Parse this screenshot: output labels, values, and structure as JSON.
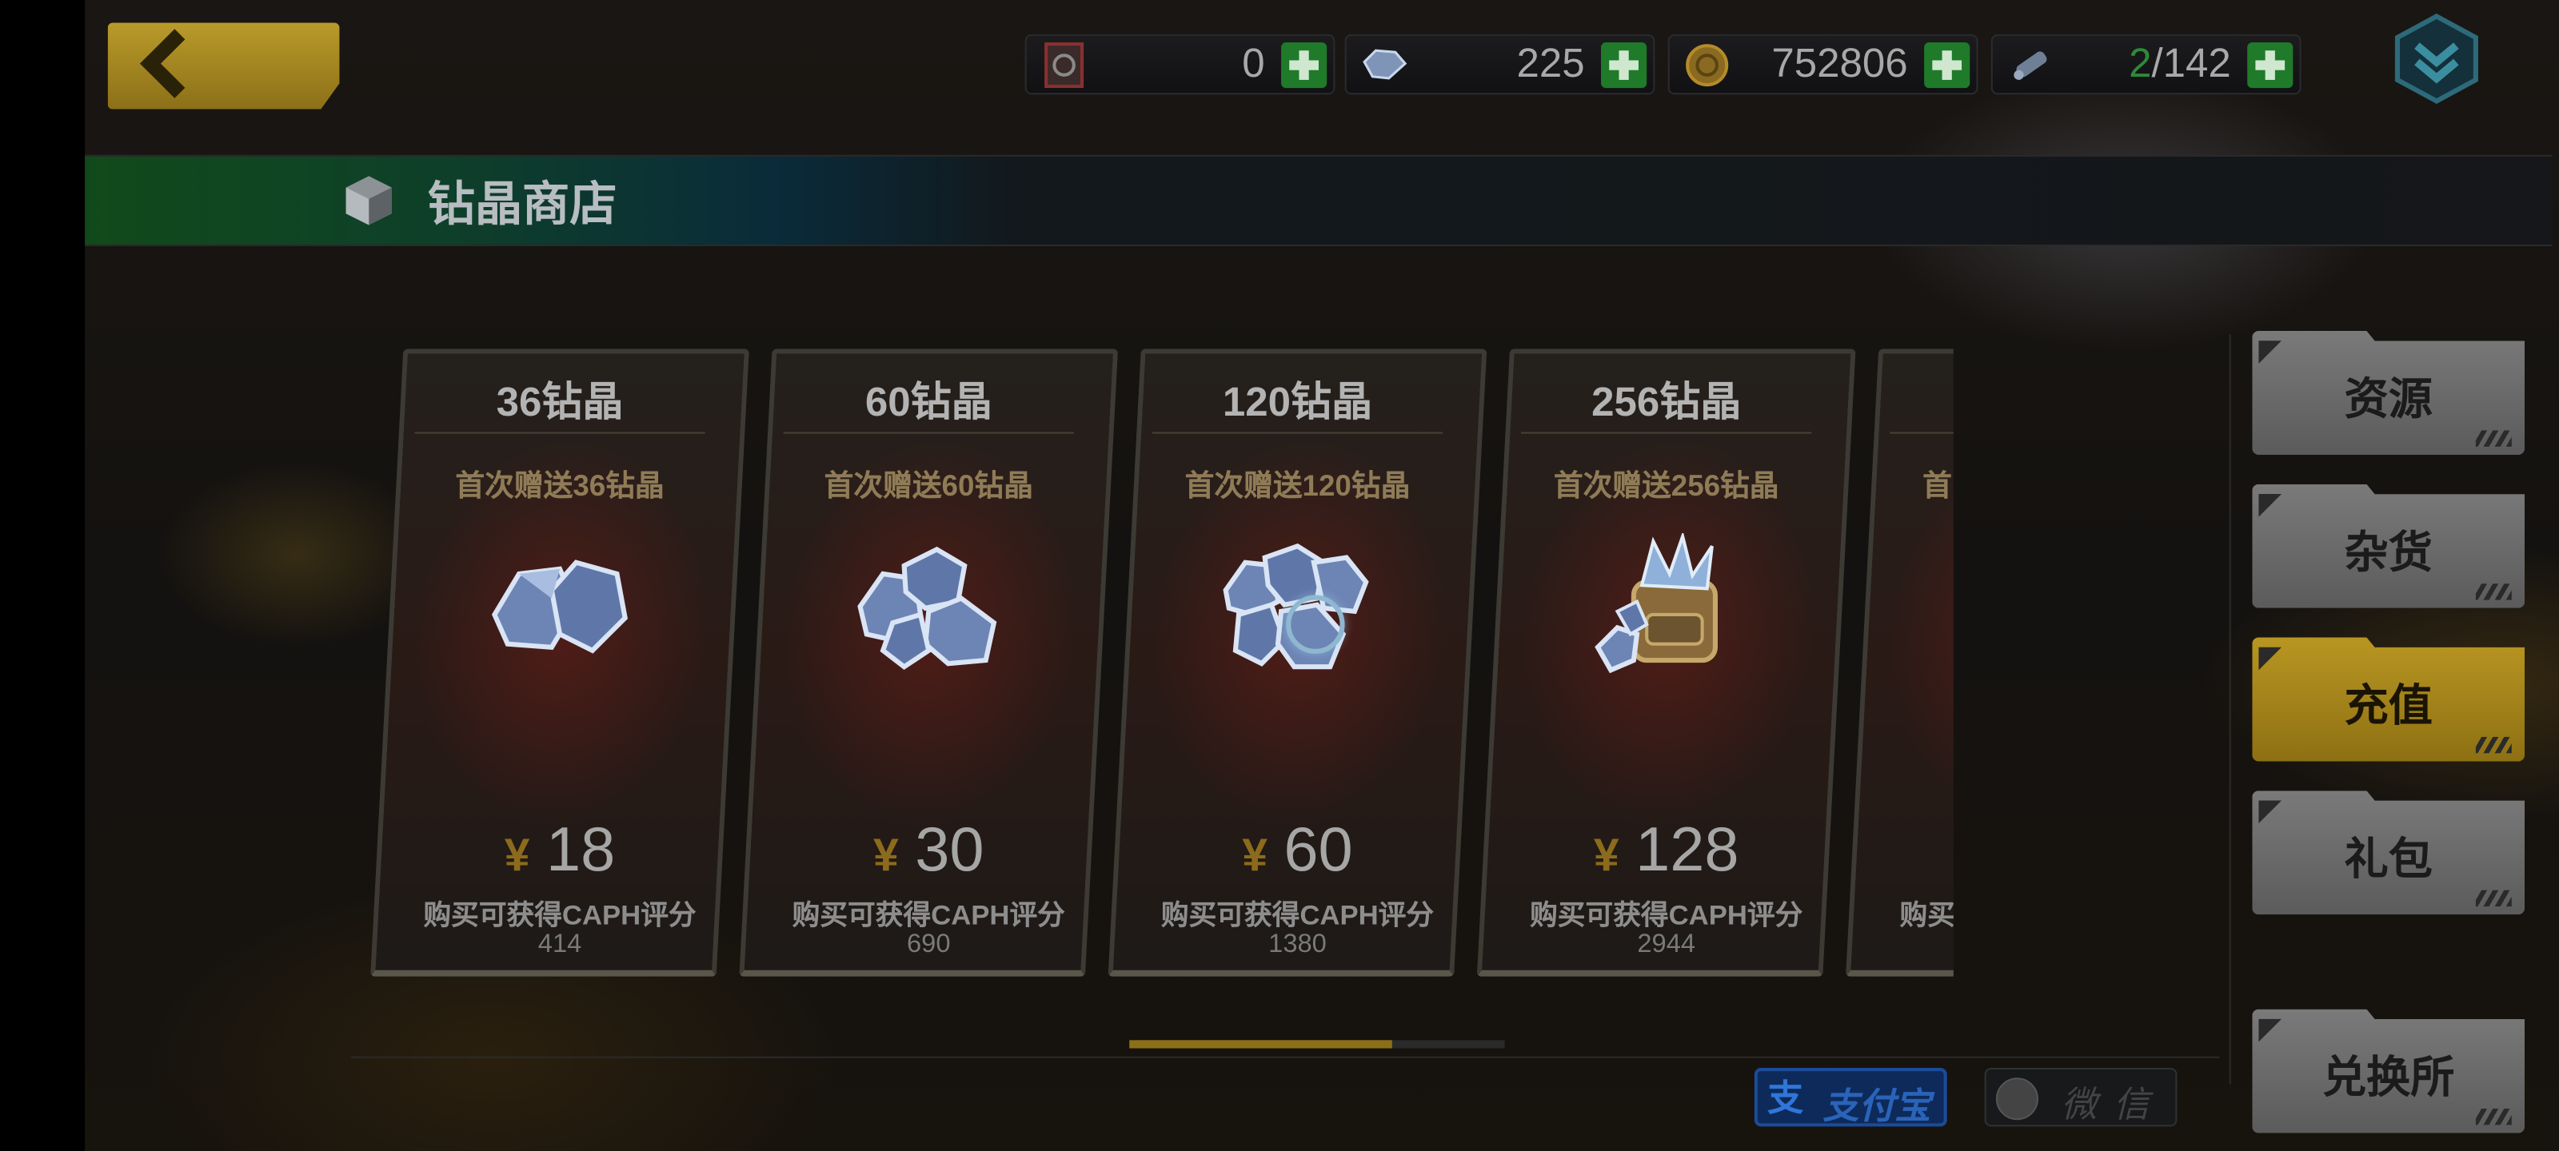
{
  "topbar": {
    "back_label": "",
    "resources": [
      {
        "name": "badge",
        "value": "0"
      },
      {
        "name": "diamond",
        "value": "225"
      },
      {
        "name": "coin",
        "value": "752806"
      },
      {
        "name": "stamina",
        "value_current": "2",
        "value_total": "/142"
      }
    ]
  },
  "shop": {
    "title": "钻晶商店"
  },
  "cards": [
    {
      "amount": "36钻晶",
      "bonus": "首次赠送36钻晶",
      "currency": "¥",
      "price": "18",
      "desc": "购买可获得CAPH评分",
      "score": "414"
    },
    {
      "amount": "60钻晶",
      "bonus": "首次赠送60钻晶",
      "currency": "¥",
      "price": "30",
      "desc": "购买可获得CAPH评分",
      "score": "690"
    },
    {
      "amount": "120钻晶",
      "bonus": "首次赠送120钻晶",
      "currency": "¥",
      "price": "60",
      "desc": "购买可获得CAPH评分",
      "score": "1380"
    },
    {
      "amount": "256钻晶",
      "bonus": "首次赠送256钻晶",
      "currency": "¥",
      "price": "128",
      "desc": "购买可获得CAPH评分",
      "score": "2944"
    },
    {
      "amount": "",
      "bonus": "首",
      "currency": "",
      "price": "",
      "desc": "购买可",
      "score": ""
    }
  ],
  "scroll": {
    "position": 0.7
  },
  "payment": {
    "alipay_logo": "支",
    "alipay_label": "支付宝",
    "wechat_label": "微信"
  },
  "side_menu": {
    "items": [
      {
        "label": "资源",
        "active": false
      },
      {
        "label": "杂货",
        "active": false
      },
      {
        "label": "充值",
        "active": true
      },
      {
        "label": "礼包",
        "active": false
      },
      {
        "label": "兑换所",
        "active": false
      }
    ]
  },
  "colors": {
    "accent_gold": "#b99a2a",
    "plus_green": "#1f7a2a",
    "alipay_blue": "#1b4c9a"
  }
}
